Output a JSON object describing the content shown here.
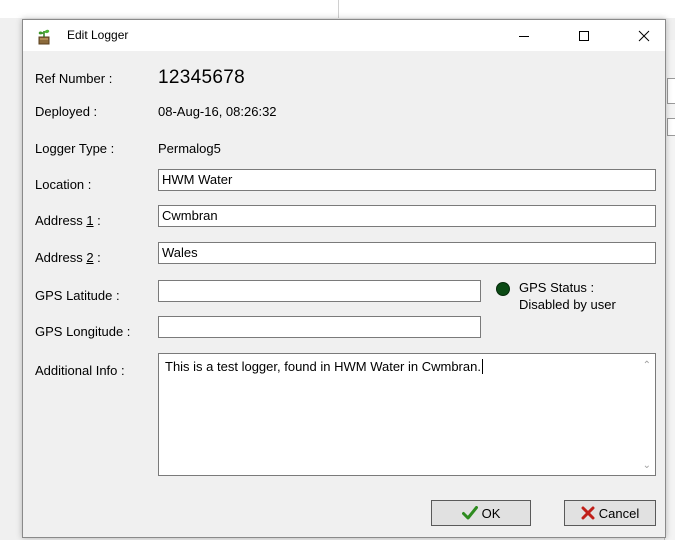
{
  "dialog": {
    "title": "Edit Logger",
    "icon": "logger-plant-icon"
  },
  "window_controls": {
    "minimize_icon": "minimize-icon",
    "maximize_icon": "maximize-icon",
    "close_icon": "close-icon"
  },
  "fields": {
    "ref_number": {
      "label": "Ref Number :",
      "value": "12345678"
    },
    "deployed": {
      "label": "Deployed :",
      "value": "08-Aug-16, 08:26:32"
    },
    "logger_type": {
      "label": "Logger Type :",
      "value": "Permalog5"
    },
    "location": {
      "label": "Location :",
      "value": "HWM Water"
    },
    "address1": {
      "label_pre": "Address ",
      "label_ul": "1",
      "label_post": " :",
      "value": "Cwmbran"
    },
    "address2": {
      "label_pre": "Address ",
      "label_ul": "2",
      "label_post": " :",
      "value": "Wales"
    },
    "gps_latitude": {
      "label": "GPS Latitude :",
      "value": ""
    },
    "gps_longitude": {
      "label": "GPS Longitude :",
      "value": ""
    },
    "additional_info": {
      "label": "Additional Info :",
      "value": "This is a test logger, found in HWM Water in Cwmbran."
    }
  },
  "gps_status": {
    "line1": "GPS Status :",
    "line2": "Disabled by user",
    "indicator_color": "#0b4a14"
  },
  "buttons": {
    "ok": {
      "label": "OK",
      "icon": "checkmark-icon",
      "icon_color": "#2e8b1f"
    },
    "cancel": {
      "label": "Cancel",
      "icon": "x-cross-icon",
      "icon_color": "#c0201a"
    }
  }
}
